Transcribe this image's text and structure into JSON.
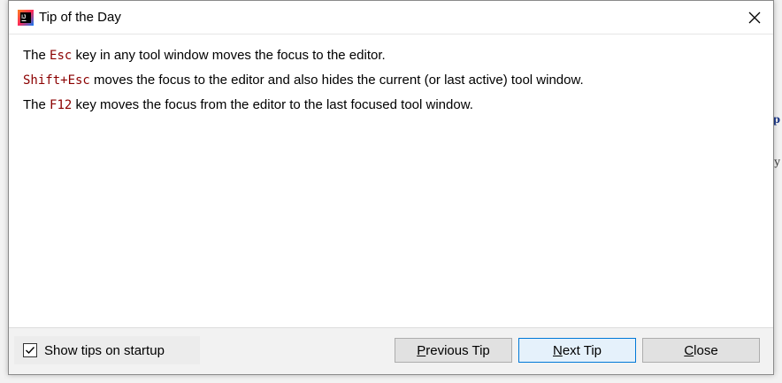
{
  "window": {
    "title": "Tip of the Day",
    "app_icon_letter": "IJ"
  },
  "tip": {
    "lines": [
      {
        "pre": "The ",
        "key": "Esc",
        "post": " key in any tool window moves the focus to the editor."
      },
      {
        "pre": "",
        "key": "Shift+Esc",
        "post": " moves the focus to the editor and also hides the current (or last active) tool window."
      },
      {
        "pre": "The ",
        "key": "F12",
        "post": " key moves the focus from the editor to the last focused tool window."
      }
    ]
  },
  "footer": {
    "show_tips_label": "Show tips on startup",
    "show_tips_checked": true,
    "prev_first": "P",
    "prev_rest": "revious Tip",
    "next_first": "N",
    "next_rest": "ext Tip",
    "close_first": "C",
    "close_rest": "lose"
  },
  "background": {
    "snippet1": "p",
    "snippet2": "y"
  },
  "colors": {
    "key_text": "#8b0000",
    "focused_button_border": "#0078d7"
  }
}
